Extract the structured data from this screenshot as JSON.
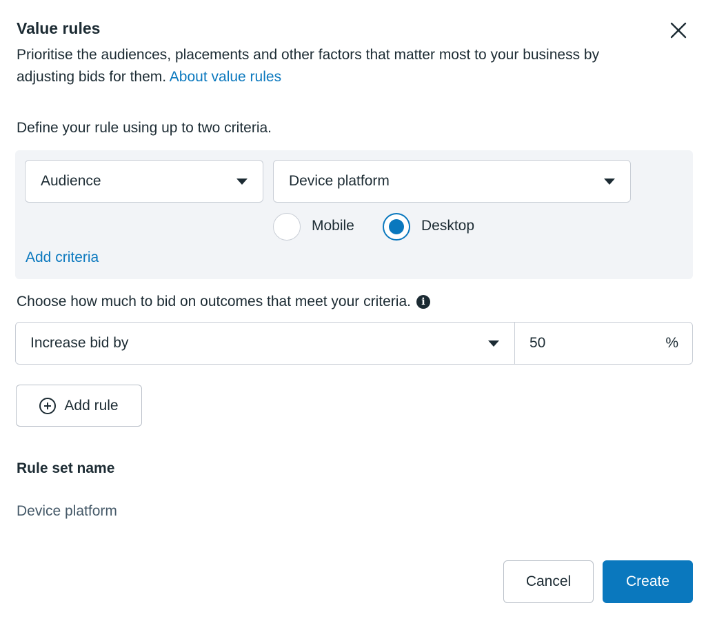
{
  "dialog": {
    "title": "Value rules",
    "description": "Prioritise the audiences, placements and other factors that matter most to your business by adjusting bids for them. ",
    "about_link": "About value rules"
  },
  "criteria": {
    "label": "Define your rule using up to two criteria.",
    "first_select": "Audience",
    "second_select": "Device platform",
    "options": [
      {
        "label": "Mobile",
        "checked": false
      },
      {
        "label": "Desktop",
        "checked": true
      }
    ],
    "add_criteria": "Add criteria"
  },
  "bid": {
    "label": "Choose how much to bid on outcomes that meet your criteria.",
    "info_glyph": "i",
    "adjustment": "Increase bid by",
    "value": "50",
    "unit": "%"
  },
  "add_rule": "Add rule",
  "rule_set": {
    "label": "Rule set name",
    "value": "Device platform"
  },
  "footer": {
    "cancel": "Cancel",
    "create": "Create"
  },
  "colors": {
    "accent": "#0a78be",
    "text": "#1c2b33",
    "panel_bg": "#f2f4f7",
    "border": "#c9ced6"
  },
  "icons": {
    "close": "close-icon",
    "caret": "caret-down-icon",
    "info": "info-icon",
    "add": "plus-circle-icon"
  }
}
